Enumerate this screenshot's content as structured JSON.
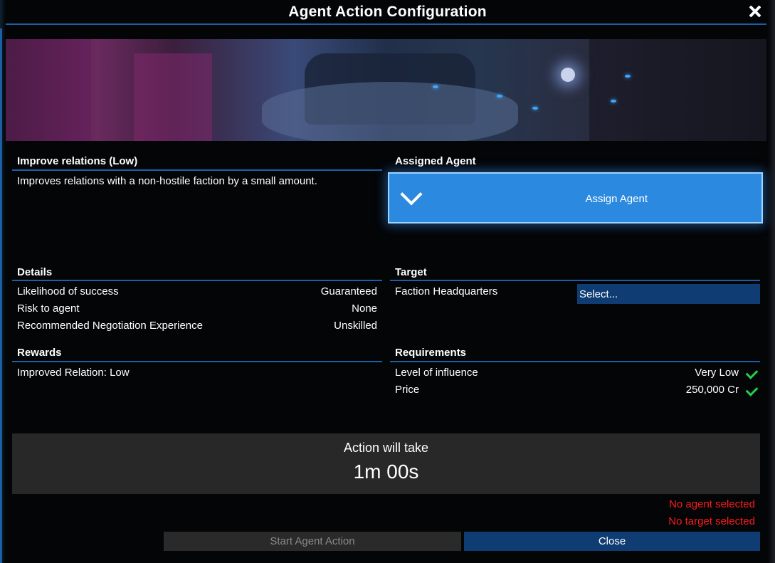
{
  "title": "Agent Action Configuration",
  "action": {
    "name": "Improve relations (Low)",
    "description": "Improves relations with a non-hostile faction by a small amount."
  },
  "assigned_agent": {
    "header": "Assigned Agent",
    "button_label": "Assign Agent"
  },
  "details": {
    "header": "Details",
    "rows": [
      {
        "label": "Likelihood of success",
        "value": "Guaranteed"
      },
      {
        "label": "Risk to agent",
        "value": "None"
      },
      {
        "label": "Recommended Negotiation Experience",
        "value": "Unskilled"
      }
    ]
  },
  "target": {
    "header": "Target",
    "label": "Faction Headquarters",
    "select_value": "Select..."
  },
  "rewards": {
    "header": "Rewards",
    "items": [
      "Improved Relation: Low"
    ]
  },
  "requirements": {
    "header": "Requirements",
    "rows": [
      {
        "label": "Level of influence",
        "value": "Very Low",
        "icon": "check-icon"
      },
      {
        "label": "Price",
        "value": "250,000 Cr",
        "icon": "check-icon"
      }
    ]
  },
  "duration": {
    "label": "Action will take",
    "value": "1m 00s"
  },
  "errors": [
    "No agent selected",
    "No target selected"
  ],
  "buttons": {
    "start": "Start Agent Action",
    "close": "Close"
  },
  "colors": {
    "accent": "#1c5fa8",
    "assign_button": "#2b8ae0",
    "error": "#ff1a1a",
    "check": "#22d14a"
  }
}
